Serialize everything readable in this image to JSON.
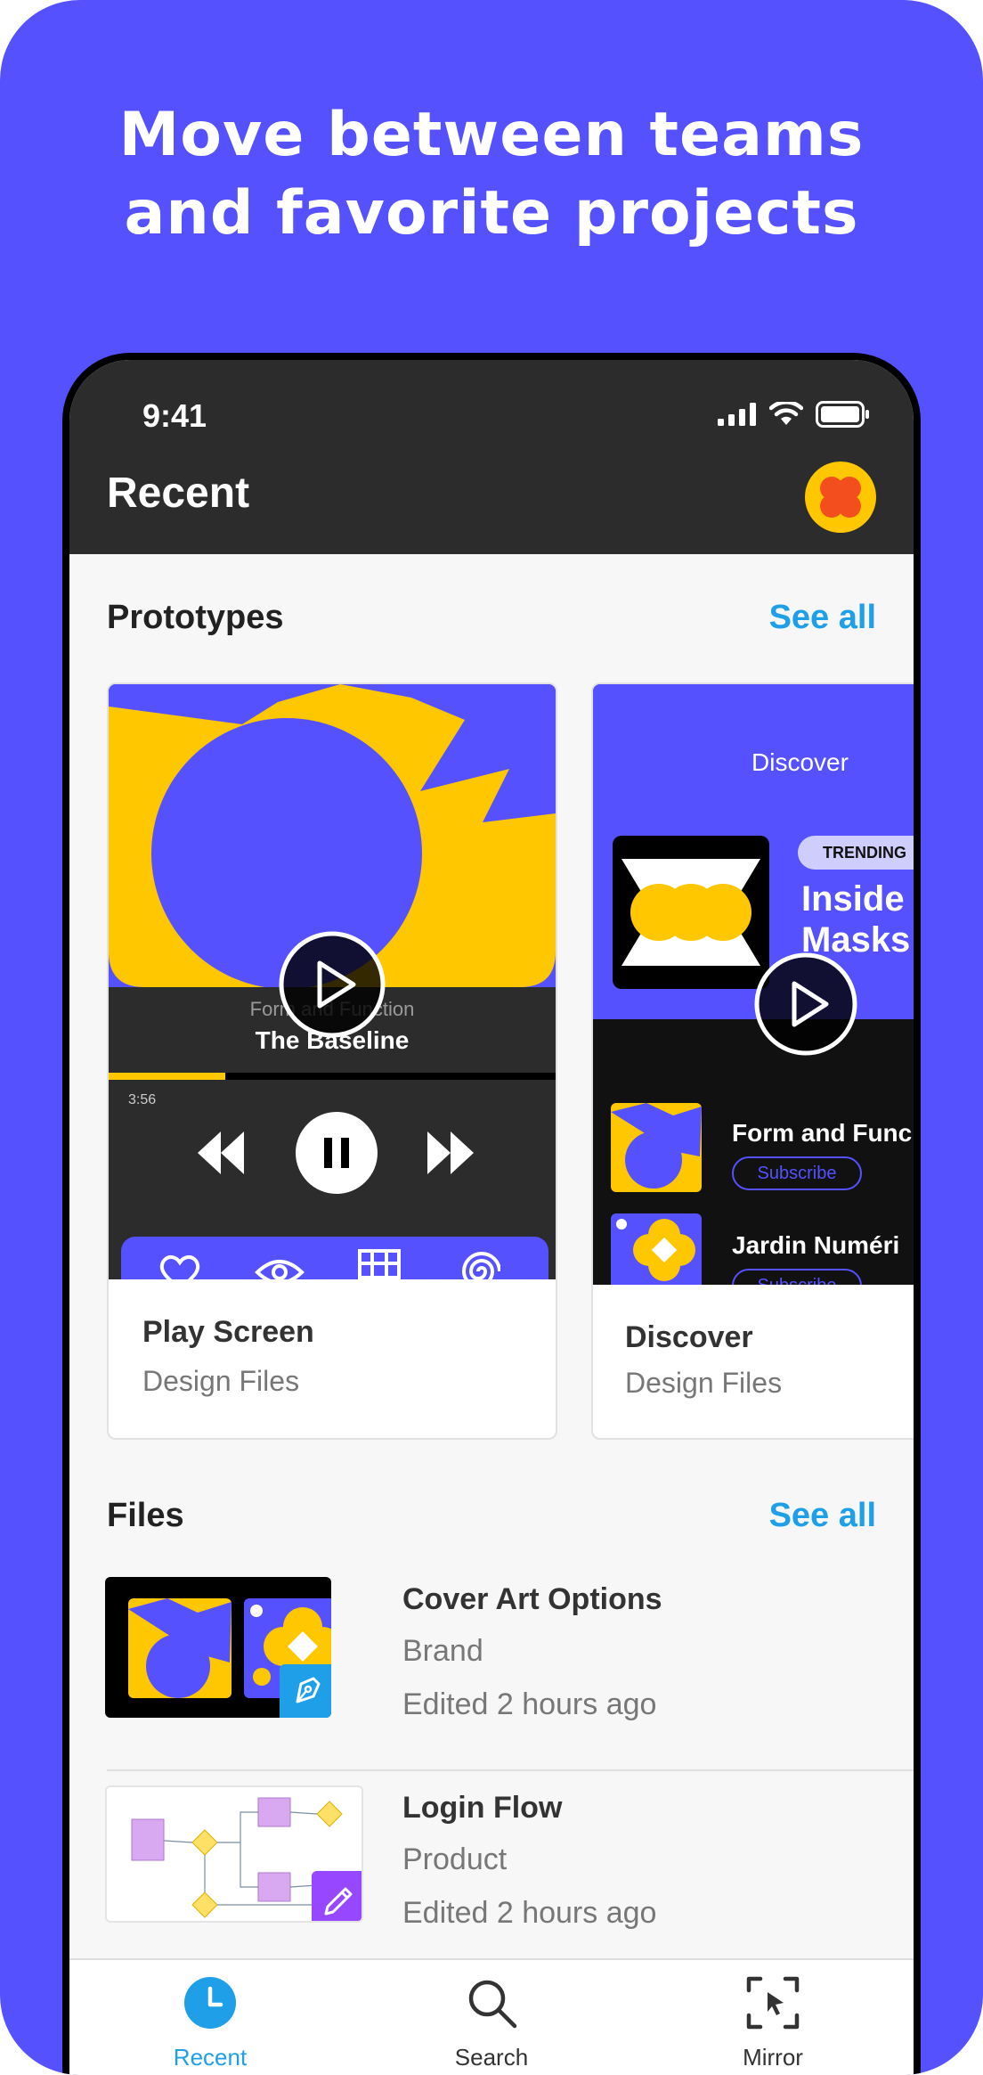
{
  "headline": {
    "line1": "Move between teams",
    "line2": "and favorite projects"
  },
  "status_bar": {
    "time": "9:41"
  },
  "header": {
    "title": "Recent"
  },
  "prototypes": {
    "title": "Prototypes",
    "see_all": "See all",
    "cards": [
      {
        "name": "Play Screen",
        "subtitle": "Design Files",
        "preview": {
          "track_line1": "Form and Function",
          "track_line2": "The Baseline",
          "elapsed": "3:56",
          "progress": 0.26
        }
      },
      {
        "name": "Discover",
        "subtitle": "Design Files",
        "preview": {
          "heading": "Discover",
          "badge": "TRENDING",
          "feature_title": "Inside Masks",
          "item1": "Form and Func",
          "item2": "Jardin Numéri",
          "subscribe": "Subscribe"
        }
      }
    ]
  },
  "files": {
    "title": "Files",
    "see_all": "See all",
    "items": [
      {
        "name": "Cover Art Options",
        "project": "Brand",
        "edited": "Edited 2 hours ago",
        "badge_icon": "pen-tool-icon"
      },
      {
        "name": "Login Flow",
        "project": "Product",
        "edited": "Edited 2 hours ago",
        "badge_icon": "pencil-icon"
      }
    ]
  },
  "tabs": [
    {
      "label": "Recent",
      "icon": "clock-icon",
      "active": true
    },
    {
      "label": "Search",
      "icon": "search-icon",
      "active": false
    },
    {
      "label": "Mirror",
      "icon": "mirror-icon",
      "active": false
    }
  ],
  "colors": {
    "brand": "#5551ff",
    "accent_yellow": "#ffc700",
    "link_blue": "#1e9fe8",
    "dark": "#2c2c2c",
    "avatar_orange": "#f24e1e"
  }
}
